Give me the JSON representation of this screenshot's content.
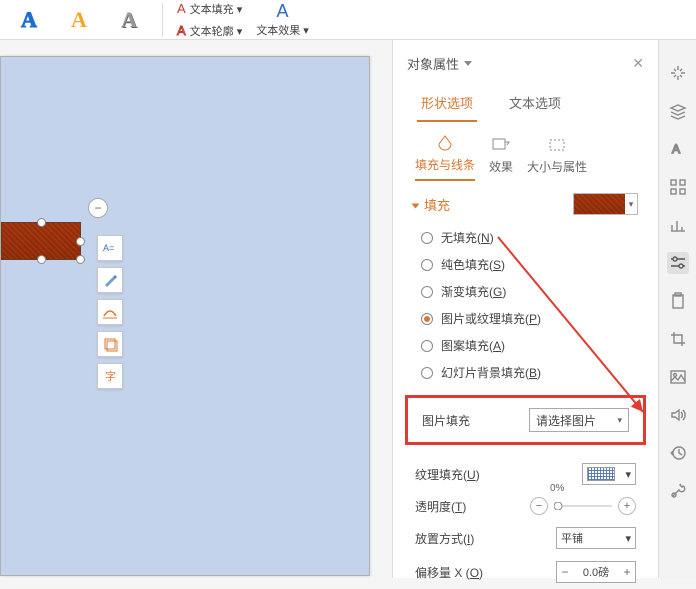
{
  "ribbon": {
    "text_fill": "文本填充",
    "text_outline": "文本轮廓",
    "text_effects": "文本效果"
  },
  "panel": {
    "title": "对象属性",
    "tabs1": {
      "shape": "形状选项",
      "text": "文本选项"
    },
    "tabs2": {
      "fill_line": "填充与线条",
      "effect": "效果",
      "size_prop": "大小与属性"
    },
    "section_fill": "填充",
    "radios": {
      "none": "无填充",
      "none_key": "N",
      "solid": "纯色填充",
      "solid_key": "S",
      "gradient": "渐变填充",
      "gradient_key": "G",
      "picture": "图片或纹理填充",
      "picture_key": "P",
      "pattern": "图案填充",
      "pattern_key": "A",
      "slidebg": "幻灯片背景填充",
      "slidebg_key": "B"
    },
    "pic_fill_label": "图片填充",
    "pic_fill_value": "请选择图片",
    "texture_label": "纹理填充",
    "texture_key": "U",
    "opacity_label": "透明度",
    "opacity_key": "T",
    "opacity_value": "0%",
    "tile_label": "放置方式",
    "tile_key": "I",
    "tile_value": "平铺",
    "offset_x_label": "偏移量 X",
    "offset_x_key": "O",
    "offset_x_value": "0.0磅"
  }
}
